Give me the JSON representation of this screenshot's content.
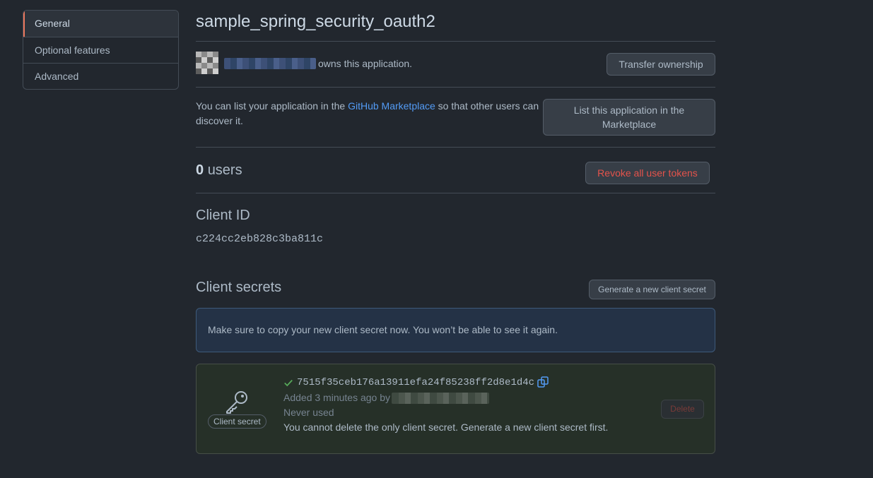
{
  "sidebar": {
    "items": [
      {
        "label": "General",
        "selected": true
      },
      {
        "label": "Optional features",
        "selected": false
      },
      {
        "label": "Advanced",
        "selected": false
      }
    ]
  },
  "app": {
    "name": "sample_spring_security_oauth2"
  },
  "ownership": {
    "owns_text": "owns this application.",
    "transfer_button": "Transfer ownership"
  },
  "marketplace": {
    "text_before": "You can list your application in the ",
    "link_text": "GitHub Marketplace",
    "text_after": " so that other users can discover it.",
    "button": "List this application in the Marketplace"
  },
  "users": {
    "count": "0",
    "label": "users",
    "revoke_button": "Revoke all user tokens"
  },
  "client_id": {
    "heading": "Client ID",
    "value": "c224cc2eb828c3ba811c"
  },
  "client_secrets": {
    "heading": "Client secrets",
    "generate_button": "Generate a new client secret",
    "flash_message": "Make sure to copy your new client secret now. You won’t be able to see it again.",
    "secret": {
      "badge": "Client secret",
      "value": "7515f35ceb176a13911efa24f85238ff2d8e1d4c",
      "added_text": "Added 3 minutes ago by",
      "usage": "Never used",
      "note": "You cannot delete the only client secret. Generate a new client secret first.",
      "delete_button": "Delete"
    }
  },
  "colors": {
    "background": "#22272e",
    "accent_selected": "#ec775c",
    "link": "#539bf5",
    "danger": "#e5534b",
    "success": "#57ab5a"
  },
  "icons": [
    "key-icon",
    "check-icon",
    "copy-icon"
  ]
}
